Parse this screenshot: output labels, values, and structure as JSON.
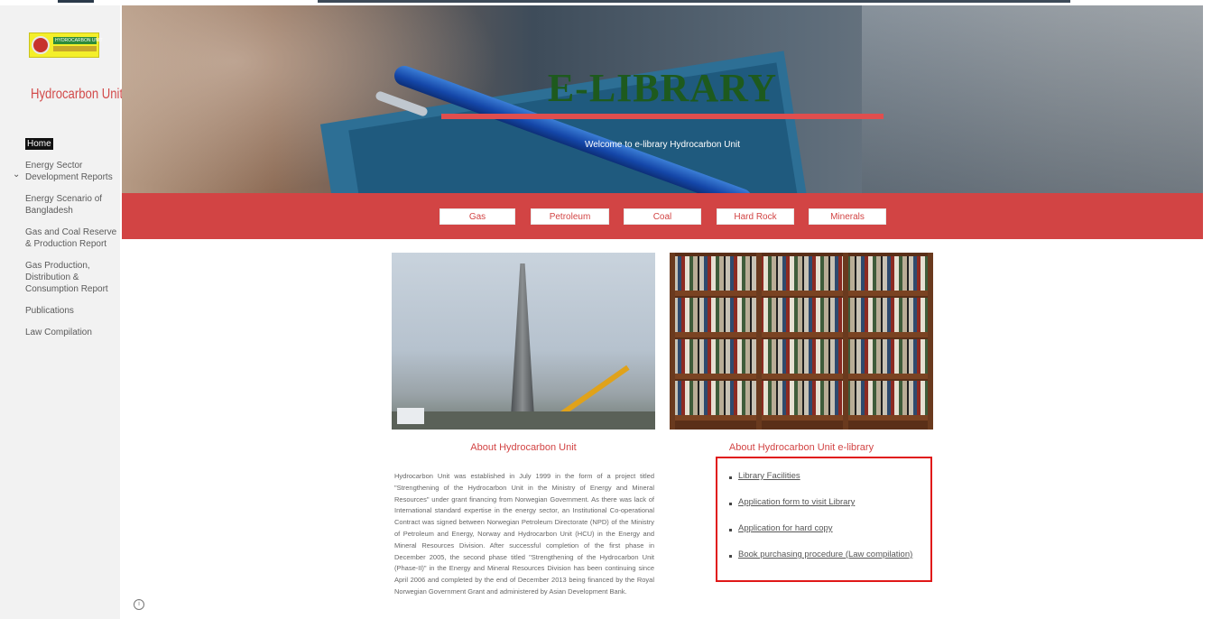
{
  "sidebar": {
    "logo_text": "HYDROCARBON UNIT",
    "brand": "Hydrocarbon Unit",
    "home": "Home",
    "items": [
      "Energy Sector Development Reports",
      "Energy Scenario of Bangladesh",
      "Gas and Coal Reserve & Production Report",
      "Gas Production, Distribution & Consumption Report",
      "Publications",
      "Law Compilation"
    ]
  },
  "hero": {
    "title": "E-LIBRARY",
    "subtitle": "Welcome to e-library Hydrocarbon Unit"
  },
  "categories": [
    "Gas",
    "Petroleum",
    "Coal",
    "Hard Rock",
    "Minerals"
  ],
  "about": {
    "title": "About Hydrocarbon Unit",
    "text": "Hydrocarbon Unit was established in July 1999 in the form of a project titled \"Strengthening of the Hydrocarbon Unit in the Ministry of Energy and Mineral Resources\" under grant financing from Norwegian Government. As there was lack of International standard expertise in the energy sector, an Institutional Co-operational Contract was signed between Norwegian Petroleum Directorate (NPD) of the Ministry of Petroleum and Energy, Norway and Hydrocarbon Unit (HCU) in the Energy and Mineral Resources Division. After successful completion of the first phase in December 2005, the second phase titled \"Strengthening of the Hydrocarbon Unit (Phase-II)\" in the Energy and Mineral Resources Division has been continuing since April 2006 and completed by the end of December 2013 being financed by the Royal Norwegian Government Grant and administered by Asian Development Bank."
  },
  "library": {
    "title": "About Hydrocarbon Unit e-library",
    "links": [
      "Library Facilities",
      "Application form to visit Library",
      "Application for hard copy",
      "Book purchasing procedure (Law compilation)"
    ]
  },
  "icons": {
    "info": "info-icon",
    "chevron": "chevron-down-icon"
  },
  "colors": {
    "accent": "#d24444",
    "title_green": "#1e5a1e",
    "highlight": "#e01818"
  }
}
